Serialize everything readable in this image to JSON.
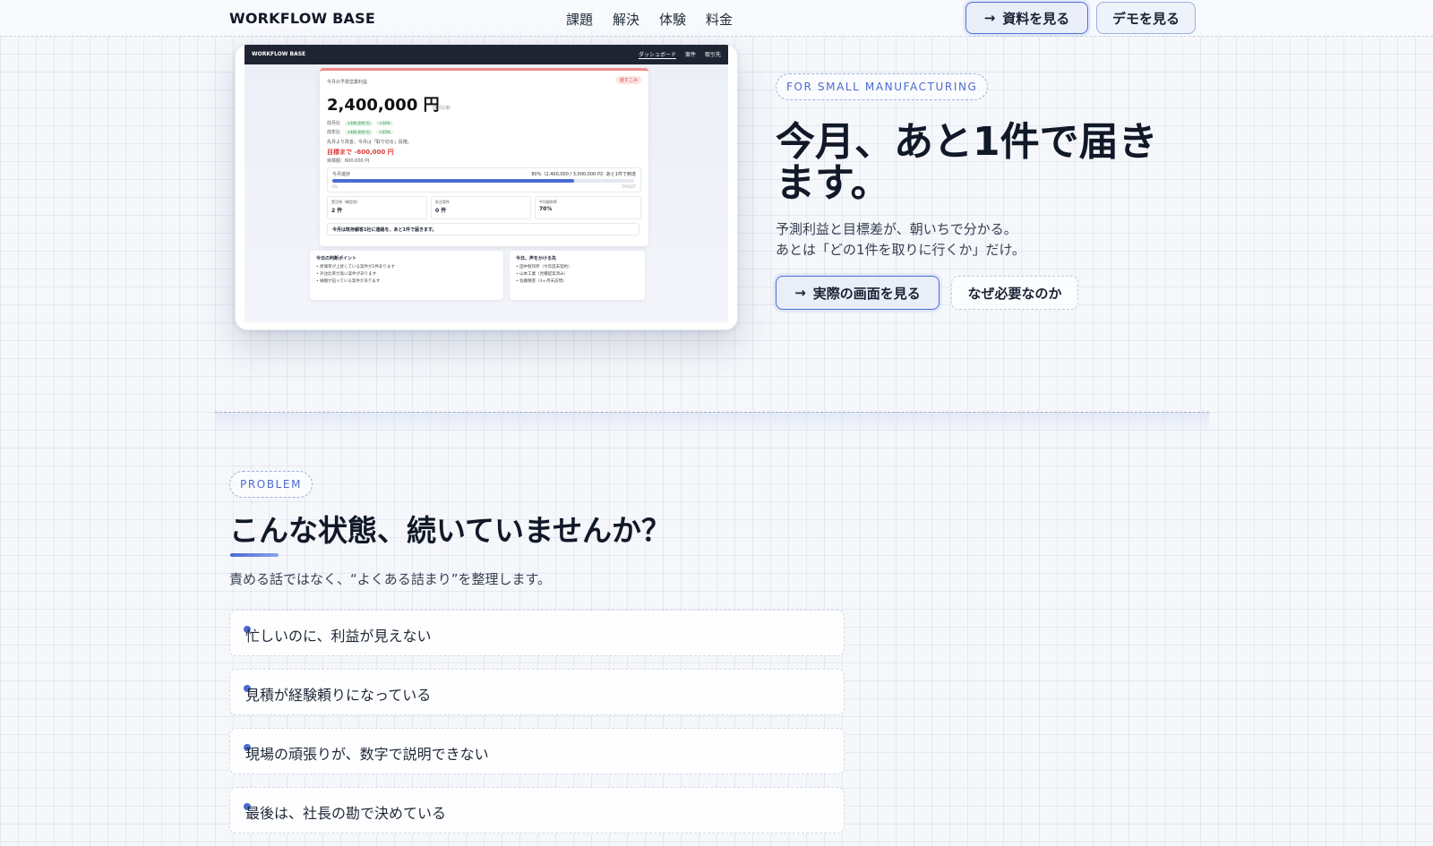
{
  "header": {
    "brand": "WORKFLOW BASE",
    "nav": [
      "課題",
      "解決",
      "体験",
      "料金"
    ],
    "primary_button": "資料を見る",
    "secondary_button": "デモを見る",
    "arrow": "→"
  },
  "mockup": {
    "brand": "WORKFLOW BASE",
    "nav": [
      "ダッシュボード",
      "案件",
      "取引先"
    ],
    "card_label": "今月の予測営業利益",
    "badge": "遅すこみ",
    "amount": "2,400,000 円",
    "amount_note": "前月比較",
    "row1_label": "前月比",
    "row1_pill1": "+300,000 円",
    "row1_pill2": "+14%",
    "row2_label": "前年比",
    "row2_pill1": "+460,000 円",
    "row2_pill2": "+23%",
    "message": "先月より改善。今月は「取り切る」段階。",
    "gap_line": "目標まで -600,000 円",
    "target_line": "目標額：600,000 円",
    "progress_label": "今月進捗",
    "progress_text": "80%（2,400,000 / 3,000,000 円）あと1件で到達",
    "progress_value": 0.8,
    "progress_left": "0%",
    "progress_right": "TARGET",
    "stat1_label": "受注残（確定前）",
    "stat1_value": "2 件",
    "stat2_label": "失注案件",
    "stat2_value": "0 件",
    "stat3_label": "平均粗利率",
    "stat3_value": "70%",
    "notice": "今月は既存顧客1社に連絡を、あと1件で届きます。",
    "panel1_title": "今日の判断ポイント",
    "panel1_items": [
      "原価率が上昇している案件が2件あります",
      "外注比率が高い案件があります",
      "納期が迫っている案件があります"
    ],
    "panel2_title": "今日、声をかける先",
    "panel2_items": [
      "田中製作所（今年度未契約）",
      "山本工業（見積提案済み）",
      "佐藤精密（3ヶ月未訪問）"
    ]
  },
  "hero": {
    "tag": "FOR SMALL MANUFACTURING",
    "title": "今月、あと1件で届きます。",
    "sub_line1": "予測利益と目標差が、朝いちで分かる。",
    "sub_line2": "あとは「どの1件を取りに行くか」だけ。",
    "cta_primary": "実際の画面を見る",
    "cta_secondary": "なぜ必要なのか"
  },
  "problem": {
    "tag": "PROBLEM",
    "title": "こんな状態、続いていませんか？",
    "description": "責める話ではなく、“よくある詰まり”を整理します。",
    "items": [
      "忙しいのに、利益が見えない",
      "見積が経験頼りになっている",
      "現場の頑張りが、数字で説明できない",
      "最後は、社長の勘で決めている"
    ]
  }
}
